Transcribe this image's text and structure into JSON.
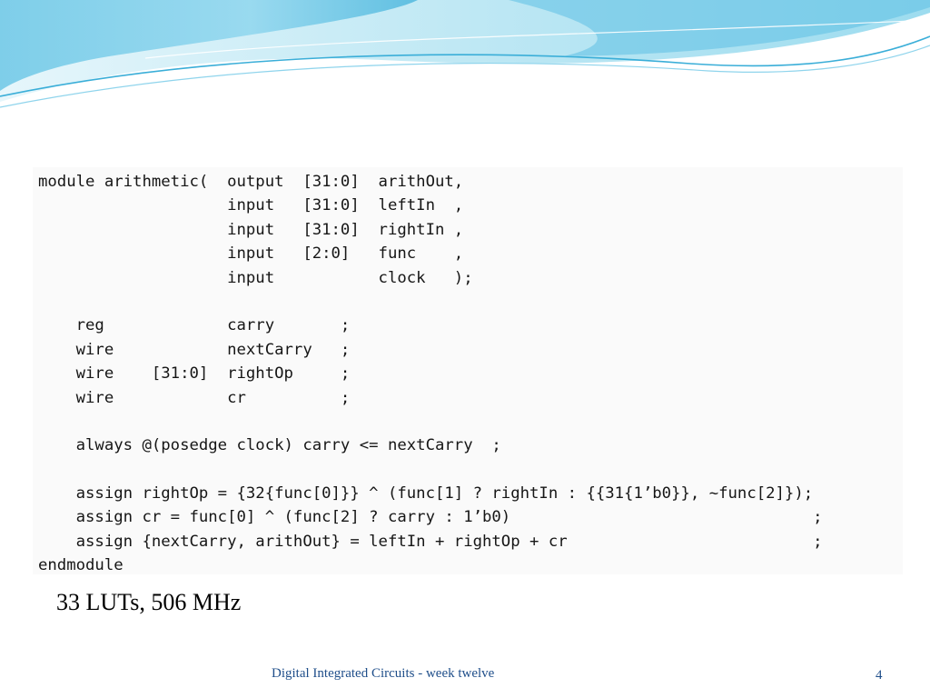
{
  "code": {
    "lines": [
      "module arithmetic(  output  [31:0]  arithOut,",
      "                    input   [31:0]  leftIn  ,",
      "                    input   [31:0]  rightIn ,",
      "                    input   [2:0]   func    ,",
      "                    input           clock   );",
      "",
      "    reg             carry       ;",
      "    wire            nextCarry   ;",
      "    wire    [31:0]  rightOp     ;",
      "    wire            cr          ;",
      "",
      "    always @(posedge clock) carry <= nextCarry  ;",
      "",
      "    assign rightOp = {32{func[0]}} ^ (func[1] ? rightIn : {{31{1’b0}}, ~func[2]});",
      "    assign cr = func[0] ^ (func[2] ? carry : 1’b0)                                ;",
      "    assign {nextCarry, arithOut} = leftIn + rightOp + cr                          ;",
      "endmodule"
    ]
  },
  "result_text": "33 LUTs, 506 MHz",
  "footer": {
    "title": "Digital Integrated Circuits - week twelve",
    "page_number": "4"
  },
  "colors": {
    "accent": "#1f4e8a",
    "wave_light": "#d5f0f8",
    "wave_mid": "#7fd0ea",
    "wave_dark": "#3aaed8"
  }
}
